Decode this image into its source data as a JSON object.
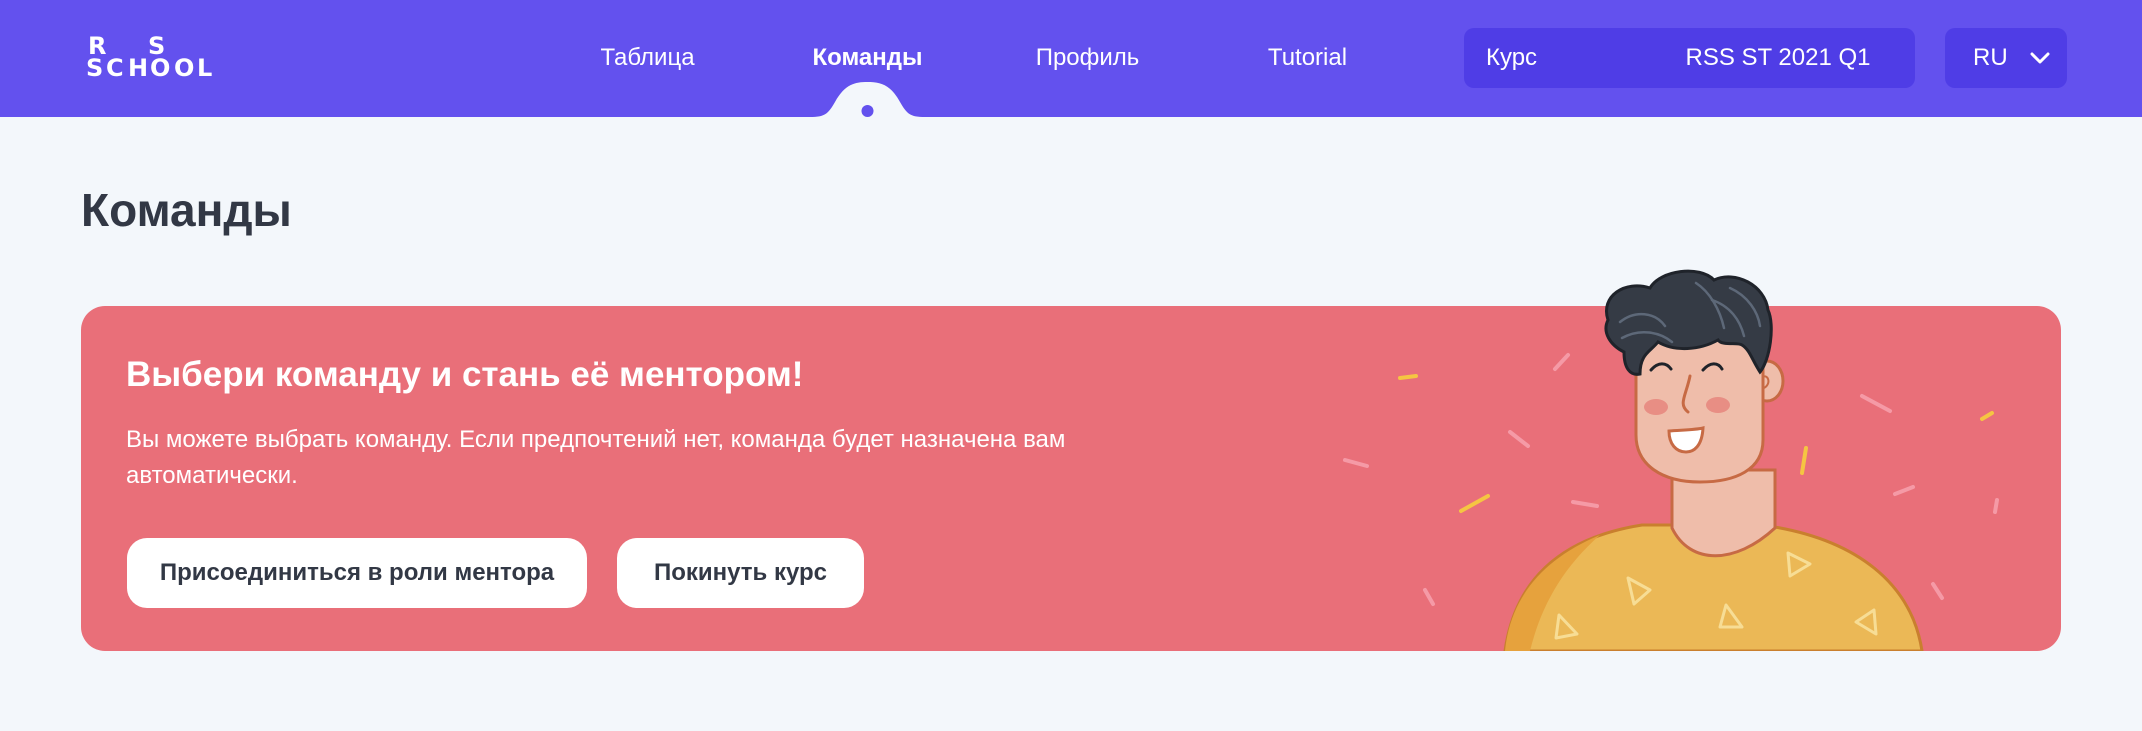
{
  "header": {
    "logo": {
      "line1": [
        "R",
        "S"
      ],
      "line2": [
        "S",
        "C",
        "H",
        "O",
        "O",
        "L"
      ]
    },
    "nav": [
      {
        "label": "Таблица",
        "active": false
      },
      {
        "label": "Команды",
        "active": true
      },
      {
        "label": "Профиль",
        "active": false
      },
      {
        "label": "Tutorial",
        "active": false
      }
    ],
    "course": {
      "label": "Курс",
      "value": "RSS ST 2021 Q1"
    },
    "language": {
      "value": "RU",
      "icon": "chevron-down-icon"
    }
  },
  "page": {
    "title": "Команды"
  },
  "banner": {
    "title": "Выбери команду и стань её ментором!",
    "text": "Вы можете выбрать команду. Если предпочтений нет, команда будет назначена вам автоматически.",
    "join_button": "Присоединиться в роли ментора",
    "leave_button": "Покинуть курс"
  },
  "colors": {
    "header_bg": "#6351ee",
    "select_bg": "#4f3de6",
    "page_bg": "#f3f7fb",
    "banner_bg": "#e96f79",
    "title_text": "#323845",
    "button_bg": "#ffffff"
  }
}
